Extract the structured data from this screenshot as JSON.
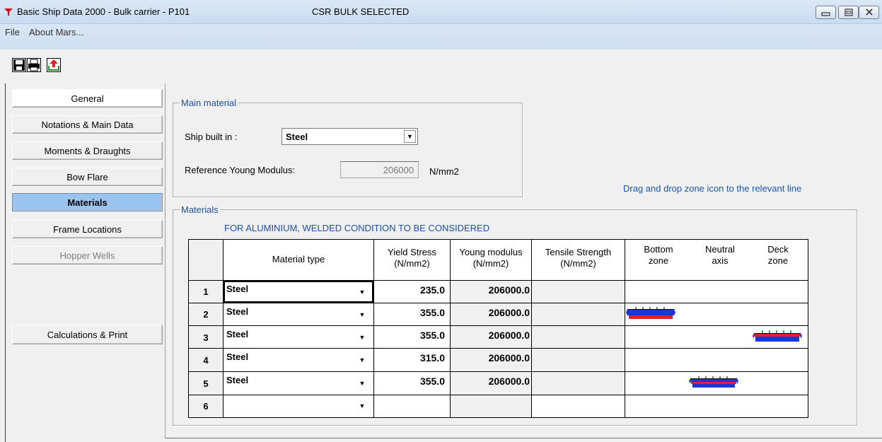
{
  "window": {
    "title": "Basic Ship Data 2000 - Bulk carrier - P101",
    "status": "CSR BULK SELECTED",
    "controls": {
      "minimize": "▭",
      "maximize": "⧉",
      "close": "✕"
    }
  },
  "menu": {
    "items": [
      "File",
      "About Mars..."
    ]
  },
  "toolbar": {
    "icons": [
      "save-icon",
      "print-icon",
      "export-icon"
    ]
  },
  "nav": {
    "items": [
      {
        "label": "General",
        "state": "normal"
      },
      {
        "label": "Notations & Main Data",
        "state": "normal"
      },
      {
        "label": "Moments & Draughts",
        "state": "normal"
      },
      {
        "label": "Bow Flare",
        "state": "normal"
      },
      {
        "label": "Materials",
        "state": "active"
      },
      {
        "label": "Frame Locations",
        "state": "normal"
      },
      {
        "label": "Hopper Wells",
        "state": "disabled"
      }
    ],
    "calc_print": "Calculations & Print"
  },
  "main_material": {
    "group_label": "Main material",
    "ship_built_label": "Ship built in :",
    "ship_built_value": "Steel",
    "young_label": "Reference Young Modulus:",
    "young_value": "206000",
    "young_unit": "N/mm2"
  },
  "hint": "Drag and drop zone icon to the relevant line",
  "materials": {
    "group_label": "Materials",
    "note": "FOR ALUMINIUM, WELDED CONDITION TO BE CONSIDERED",
    "headers": {
      "material_type": "Material type",
      "yield_1": "Yield Stress",
      "yield_2": "(N/mm2)",
      "young_1": "Young modulus",
      "young_2": "(N/mm2)",
      "tensile_1": "Tensile Strength",
      "tensile_2": "(N/mm2)",
      "bottom_1": "Bottom",
      "bottom_2": "zone",
      "neutral_1": "Neutral",
      "neutral_2": "axis",
      "deck_1": "Deck",
      "deck_2": "zone"
    },
    "rows": [
      {
        "n": "1",
        "material": "Steel",
        "yield": "235.0",
        "young": "206000.0",
        "zone": ""
      },
      {
        "n": "2",
        "material": "Steel",
        "yield": "355.0",
        "young": "206000.0",
        "zone": "bottom"
      },
      {
        "n": "3",
        "material": "Steel",
        "yield": "355.0",
        "young": "206000.0",
        "zone": "deck"
      },
      {
        "n": "4",
        "material": "Steel",
        "yield": "315.0",
        "young": "206000.0",
        "zone": ""
      },
      {
        "n": "5",
        "material": "Steel",
        "yield": "355.0",
        "young": "206000.0",
        "zone": "neutral"
      },
      {
        "n": "6",
        "material": "",
        "yield": "",
        "young": "",
        "zone": ""
      }
    ]
  },
  "colors": {
    "accent_blue": "#1f4fa6",
    "active_tab": "#9ac4f0",
    "zone_red": "#e0202a",
    "zone_blue": "#1a35d8"
  }
}
